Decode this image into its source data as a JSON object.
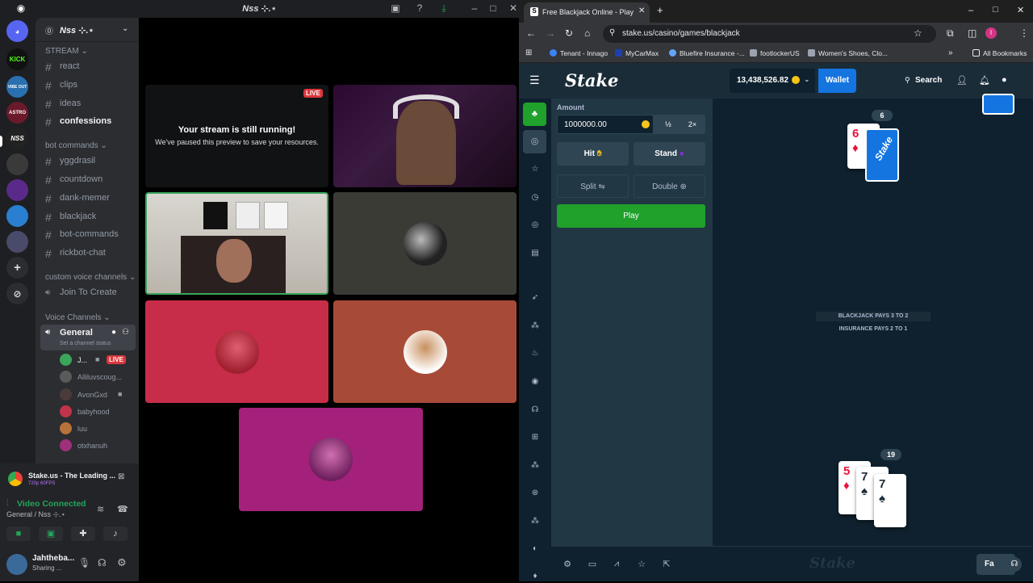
{
  "discord": {
    "window_title": "Nss ⊹.⋆",
    "server_name": "Nss ⊹.⋆",
    "server_badges": [
      "KICK",
      "VIBE OUT",
      "ASTRO",
      "NSS"
    ],
    "categories": {
      "stream": "STREAM",
      "bot": "bot commands",
      "custom_voice": "custom voice channels",
      "voice": "Voice Channels"
    },
    "stream_channels": [
      "react",
      "clips",
      "ideas",
      "confessions"
    ],
    "bot_channels": [
      "yggdrasil",
      "countdown",
      "dank-memer",
      "blackjack",
      "bot-commands",
      "rickbot-chat"
    ],
    "join_to_create": "Join To Create",
    "voice_channel": {
      "name": "General",
      "status": "Set a channel status",
      "users": [
        {
          "name": "J...",
          "live": "LIVE",
          "color": "#3ba55c"
        },
        {
          "name": "Alliluvscoug...",
          "color": "#5a5a5a"
        },
        {
          "name": "AvonGxd",
          "color": "#4a3a3a"
        },
        {
          "name": "babyhood",
          "color": "#c0344b"
        },
        {
          "name": "luu",
          "color": "#b7713a"
        },
        {
          "name": "otxhanuh",
          "color": "#a0307a"
        }
      ]
    },
    "stream_notice": {
      "title": "Your stream is still running!",
      "subtitle": "We've paused this preview to save your resources.",
      "live_label": "LIVE"
    },
    "activity": {
      "title": "Stake.us - The Leading ...",
      "subtitle": "720p 60FPS"
    },
    "voice_status": {
      "title": "Video Connected",
      "subtitle": "General / Nss ⊹.⋆"
    },
    "user": {
      "name": "Jahtheba...",
      "status": "Sharing ..."
    },
    "colors": {
      "accent_green": "#23a55a",
      "live_red": "#da373c"
    }
  },
  "browser": {
    "tab_title": "Free Blackjack Online - Play Bla",
    "url": "stake.us/casino/games/blackjack",
    "bookmarks": [
      "Tenant - Innago",
      "MyCarMax",
      "Bluefire Insurance -...",
      "footlockerUS",
      "Women's Shoes, Clo..."
    ],
    "all_bookmarks": "All Bookmarks",
    "profile_initial": "I"
  },
  "stake": {
    "logo": "Stake",
    "balance": "13,438,526.82",
    "wallet": "Wallet",
    "search": "Search",
    "amount_label": "Amount",
    "amount_value": "1000000.00",
    "half": "½",
    "double_amt": "2×",
    "hit": "Hit",
    "stand": "Stand",
    "split": "Split",
    "double": "Double",
    "play": "Play",
    "dealer_score": "6",
    "player_score": "19",
    "dealer_card": {
      "rank": "6",
      "suit": "♦"
    },
    "player_cards": [
      {
        "rank": "5",
        "suit": "♦",
        "color": "#e9113c"
      },
      {
        "rank": "7",
        "suit": "♠",
        "color": "#1a2c38"
      },
      {
        "rank": "7",
        "suit": "♠",
        "color": "#1a2c38"
      }
    ],
    "table_text_1": "BLACKJACK PAYS 3 TO 2",
    "table_text_2": "INSURANCE PAYS 2 TO 1",
    "footer_button": "Fa",
    "footer_watermark": "Stake",
    "colors": {
      "play_green": "#1fa12b",
      "wallet_blue": "#1475e1",
      "red_suit": "#e9113c"
    }
  }
}
